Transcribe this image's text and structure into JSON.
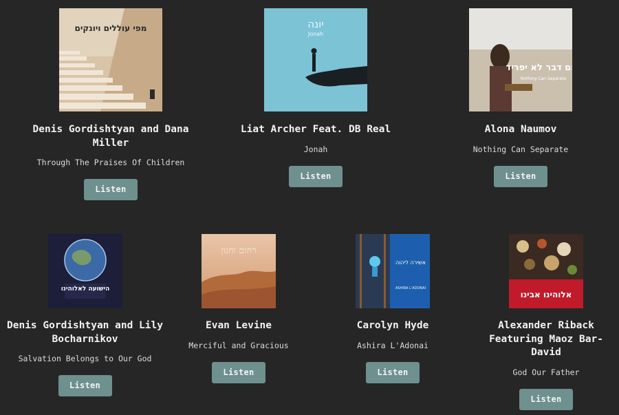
{
  "button_label": "Listen",
  "albums": [
    {
      "artist": "Denis Gordishtyan and Dana Miller",
      "song": "Through The Praises Of Children",
      "cover_text": "מפי עוללים ויונקים"
    },
    {
      "artist": "Liat Archer Feat. DB Real",
      "song": "Jonah",
      "cover_text": "יונה",
      "cover_subtext": "Jonah"
    },
    {
      "artist": "Alona Naumov",
      "song": "Nothing Can Separate",
      "cover_text": "שום דבר לא יפריד",
      "cover_subtext": "Nothing Can Separate"
    },
    {
      "artist": "Denis Gordishtyan and Lily Bocharnikov",
      "song": "Salvation Belongs to Our God",
      "cover_text": "הישועה לאלוהינו"
    },
    {
      "artist": "Evan Levine",
      "song": "Merciful and Gracious",
      "cover_text": "רחום וחנון"
    },
    {
      "artist": "Carolyn Hyde",
      "song": "Ashira L'Adonai",
      "cover_text": "אשירה ליהוה",
      "cover_subtext": "ASHIRA L'ADONAI"
    },
    {
      "artist": "Alexander Riback Featuring Maoz Bar-David",
      "song": "God Our Father",
      "cover_text": "אלוהינו אבינו"
    }
  ]
}
